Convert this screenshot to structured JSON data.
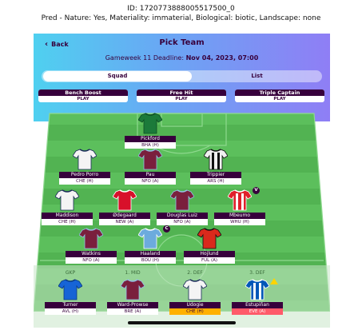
{
  "caption": {
    "line1": "ID: 1720773888005517500_0",
    "line2": "Pred - Nature: Yes, Materiality: immaterial, Biological: biotic, Landscape: none"
  },
  "header": {
    "back_label": "Back",
    "title": "Pick Team",
    "deadline_label": "Gameweek 11 Deadline:",
    "deadline_value": "Nov 04, 2023, 07:00"
  },
  "tabs": [
    {
      "label": "Squad",
      "selected": true
    },
    {
      "label": "List",
      "selected": false
    }
  ],
  "chips": [
    {
      "name": "Bench Boost",
      "status": "PLAY"
    },
    {
      "name": "Free Hit",
      "status": "PLAY"
    },
    {
      "name": "Triple Captain",
      "status": "PLAY"
    }
  ],
  "players": {
    "gk": {
      "name": "Pickford",
      "fixture": "BHA (H)",
      "shirt": "#1b7a3a",
      "trim": "#0d4d22"
    },
    "d1": {
      "name": "Pedro Porro",
      "fixture": "CHE (H)",
      "shirt": "#f4f4f4",
      "trim": "#1b2a5a"
    },
    "d2": {
      "name": "Pau",
      "fixture": "NFO (A)",
      "shirt": "#7a1f3d",
      "trim": "#94bee5"
    },
    "d3": {
      "name": "Trippier",
      "fixture": "ARS (H)",
      "shirt": "#f0f0f0",
      "trim": "#111111",
      "stripes": true
    },
    "m1": {
      "name": "Maddison",
      "fixture": "CHE (H)",
      "shirt": "#f4f4f4",
      "trim": "#1b2a5a"
    },
    "m2": {
      "name": "Ødegaard",
      "fixture": "NEW (A)",
      "shirt": "#d8102a",
      "trim": "#ffffff"
    },
    "m3": {
      "name": "Douglas Luiz",
      "fixture": "NFO (A)",
      "shirt": "#7a1f3d",
      "trim": "#94bee5"
    },
    "m4": {
      "name": "Mbeumo",
      "fixture": "WHU (H)",
      "shirt": "#e0202b",
      "trim": "#ffffff",
      "stripes": true,
      "badge": "V"
    },
    "f1": {
      "name": "Watkins",
      "fixture": "NFO (A)",
      "shirt": "#7a1f3d",
      "trim": "#94bee5"
    },
    "f2": {
      "name": "Haaland",
      "fixture": "BOU (H)",
      "shirt": "#6cabdd",
      "trim": "#ffffff",
      "badge": "C"
    },
    "f3": {
      "name": "Hojlund",
      "fixture": "FUL (A)",
      "shirt": "#da291c",
      "trim": "#111111"
    }
  },
  "bench": [
    {
      "label": "GKP",
      "name": "Turner",
      "fixture": "AVL (H)",
      "shirt": "#1664d6",
      "trim": "#0b3a80",
      "fixture_style": "normal"
    },
    {
      "label": "1. MID",
      "name": "Ward-Prowse",
      "fixture": "BRE (A)",
      "shirt": "#7a1f3d",
      "trim": "#94bee5",
      "fixture_style": "normal"
    },
    {
      "label": "2. DEF",
      "name": "Udogie",
      "fixture": "CHE (H)",
      "shirt": "#f4f4f4",
      "trim": "#1b2a5a",
      "fixture_style": "orange"
    },
    {
      "label": "3. DEF",
      "name": "Estupiñan",
      "fixture": "EVE (A)",
      "shirt": "#0057b8",
      "trim": "#ffffff",
      "stripes": true,
      "fixture_style": "red",
      "warning": true
    }
  ],
  "colors": {
    "primary": "#37003c",
    "pitch_light": "#5cbf5c",
    "pitch_dark": "#4fb04f"
  }
}
